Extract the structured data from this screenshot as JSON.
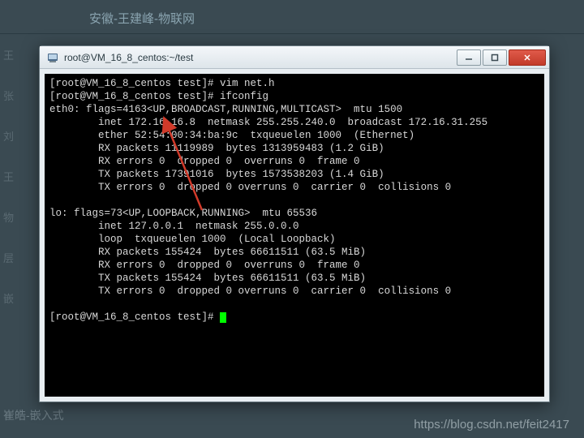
{
  "background": {
    "header_title": "安徽-王建峰-物联网",
    "side_items": [
      "王",
      "张",
      "刘",
      "王",
      "物",
      "层",
      "嵌"
    ],
    "bottom_text": "崔皓-嵌入式"
  },
  "watermark": "https://blog.csdn.net/feit2417",
  "window": {
    "title": "root@VM_16_8_centos:~/test"
  },
  "terminal": {
    "lines": [
      "[root@VM_16_8_centos test]# vim net.h",
      "[root@VM_16_8_centos test]# ifconfig",
      "eth0: flags=4163<UP,BROADCAST,RUNNING,MULTICAST>  mtu 1500",
      "        inet 172.16.16.8  netmask 255.255.240.0  broadcast 172.16.31.255",
      "        ether 52:54:00:34:ba:9c  txqueuelen 1000  (Ethernet)",
      "        RX packets 11119989  bytes 1313959483 (1.2 GiB)",
      "        RX errors 0  dropped 0  overruns 0  frame 0",
      "        TX packets 17391016  bytes 1573538203 (1.4 GiB)",
      "        TX errors 0  dropped 0 overruns 0  carrier 0  collisions 0",
      "",
      "lo: flags=73<UP,LOOPBACK,RUNNING>  mtu 65536",
      "        inet 127.0.0.1  netmask 255.0.0.0",
      "        loop  txqueuelen 1000  (Local Loopback)",
      "        RX packets 155424  bytes 66611511 (63.5 MiB)",
      "        RX errors 0  dropped 0  overruns 0  frame 0",
      "        TX packets 155424  bytes 66611511 (63.5 MiB)",
      "        TX errors 0  dropped 0 overruns 0  carrier 0  collisions 0",
      "",
      "[root@VM_16_8_centos test]# "
    ]
  },
  "annotation": {
    "arrow_color": "#d13a2a"
  }
}
